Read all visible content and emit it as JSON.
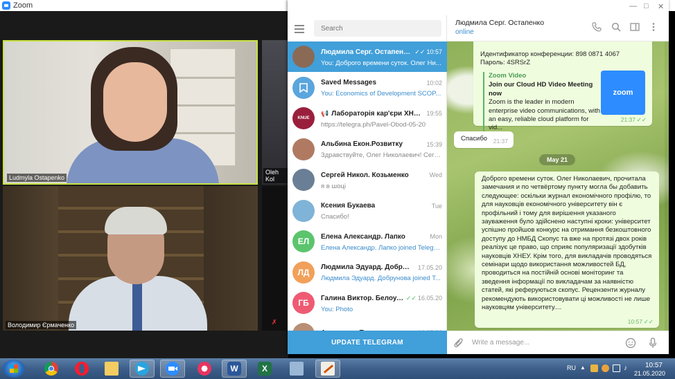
{
  "zoom": {
    "title": "Zoom",
    "participants": [
      {
        "name": "Ludmyla Ostapenko"
      },
      {
        "name": "Oleh Kol"
      },
      {
        "name": "Володимир Єрмаченко"
      }
    ]
  },
  "telegram": {
    "search_placeholder": "Search",
    "update_button": "UPDATE TELEGRAM",
    "chats": [
      {
        "name": "Людмила Серг. Остапенко",
        "time": "10:57",
        "last": "You: Доброго времени суток. Олег Ни...",
        "read": true,
        "active": true,
        "avatar_color": "#8a6a55"
      },
      {
        "name": "Saved Messages",
        "time": "10:02",
        "last": "You: Economics of Development SCOP...",
        "blue": true,
        "avatar_color": "#5aa5dd",
        "icon": "bookmark-icon"
      },
      {
        "name": "Лабораторія кар'єри ХНЕУ",
        "time": "19:55",
        "last": "https://telegra.ph/Pavel-Obod-05-20",
        "channel": true,
        "avatar_color": "#9a1f3d",
        "avatar_text": "KNUE"
      },
      {
        "name": "Альбина Екон.Розвитку",
        "time": "15:39",
        "last": "Здравствуйте, Олег Николаевич! Сего...",
        "avatar_color": "#b07a62"
      },
      {
        "name": "Сергей Никол. Козьменко",
        "time": "Wed",
        "last": "я в шоці",
        "avatar_color": "#6a7f95"
      },
      {
        "name": "Ксения Букаева",
        "time": "Tue",
        "last": "Спасибо!",
        "avatar_color": "#7fb3d8"
      },
      {
        "name": "Елена Александр. Лапко",
        "time": "Mon",
        "last": "Елена Александр. Лапко joined Telegra...",
        "blue": true,
        "initials": "ЕЛ",
        "avatar_color": "#5cc46d"
      },
      {
        "name": "Людмила Эдуард. Добрунова",
        "time": "17.05.20",
        "last": "Людмила Эдуард. Добрунова joined T...",
        "blue": true,
        "initials": "ЛД",
        "avatar_color": "#f1a05a"
      },
      {
        "name": "Галина Виктор. Белоусо...",
        "time": "16.05.20",
        "last": "You: Photo",
        "blue": true,
        "read": true,
        "initials": "ГБ",
        "avatar_color": "#ef5a73"
      },
      {
        "name": "Анастасия Прощина",
        "time": "16.05.20",
        "last": "",
        "avatar_color": "#b88f74"
      }
    ],
    "peer": {
      "name": "Людмила Серг. Остапенко",
      "status": "online"
    },
    "messages": {
      "m1_line1": "Идентификатор конференции: 898 0871 4067",
      "m1_line2": "Пароль: 4SRSrZ",
      "preview_site": "Zoom Video",
      "preview_title": "Join our Cloud HD Video Meeting now",
      "preview_desc": "Zoom is the leader in modern enterprise video communications, with an easy, reliable cloud platform for vid...",
      "preview_logo": "zoom",
      "m1_time": "21:37",
      "m2_text": "Спасибо",
      "m2_time": "21:37",
      "date_divider": "May 21",
      "m3_text": "Доброго времени суток. Олег Николаевич, прочитала замечания и по четвёртому пункту могла бы добавить следующее: оскільки журнал економічного профілю, то для науковців економічного університету він є профільний і тому для вирішення указаного зауваження було здійснено наступні кроки: університет успішно пройшов конкурс на отримання безкоштовного доступу до НМБД Скопус та вже на протязі двох років реалізує це право, що сприяє популяризації здобутків науковців ХНЕУ. Крім того, для викладачів проводяться семінари щодо використання можливостей БД, проводиться на постійній основі моніторинг та зведення інформації по викладачам за наявністю статей, які реферуються скопус. Рецензенти журналу рекомендують використовувати ці можливості не лише науковцям університету....",
      "m3_time": "10:57"
    },
    "composer_placeholder": "Write a message..."
  },
  "taskbar": {
    "language": "RU",
    "time": "10:57",
    "date": "21.05.2020"
  }
}
